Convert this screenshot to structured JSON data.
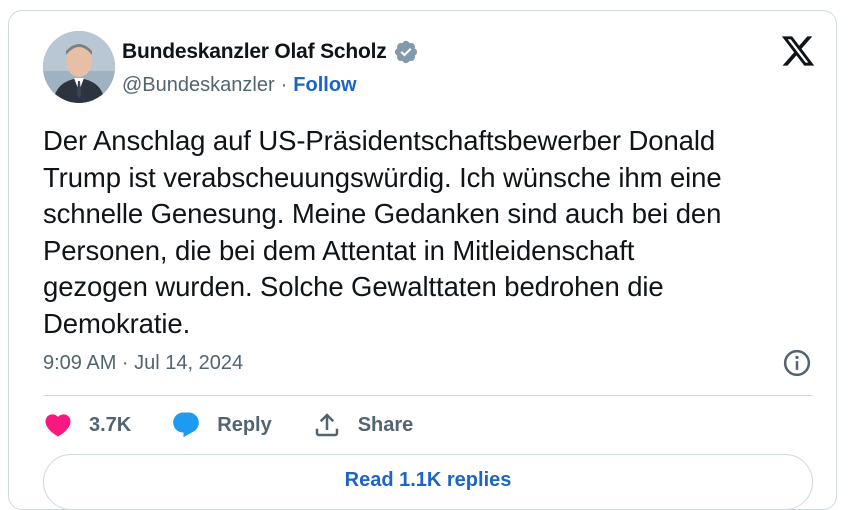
{
  "author": {
    "display_name": "Bundeskanzler Olaf Scholz",
    "handle": "@Bundeskanzler",
    "separator": "·",
    "follow_label": "Follow",
    "verified": true
  },
  "tweet": {
    "text": "Der Anschlag auf US-Präsidentschaftsbewerber Donald\nTrump ist verabscheuungswürdig. Ich wünsche ihm eine\nschnelle Genesung. Meine Gedanken sind auch bei den\nPersonen, die bei dem Attentat in Mitleidenschaft\ngezogen wurden. Solche Gewalttaten bedrohen die\nDemokratie.",
    "timestamp": "9:09 AM · Jul 14, 2024"
  },
  "actions": {
    "likes_count": "3.7K",
    "reply_label": "Reply",
    "share_label": "Share"
  },
  "read_replies_label": "Read 1.1K replies",
  "colors": {
    "like_red": "#f91880",
    "reply_blue": "#1d9bf0",
    "link_blue": "#1d64c8",
    "muted_gray": "#536471",
    "border": "#cfd9de"
  },
  "icons": [
    "verified-badge-icon",
    "x-logo-icon",
    "info-icon",
    "heart-icon",
    "reply-bubble-icon",
    "share-icon"
  ]
}
